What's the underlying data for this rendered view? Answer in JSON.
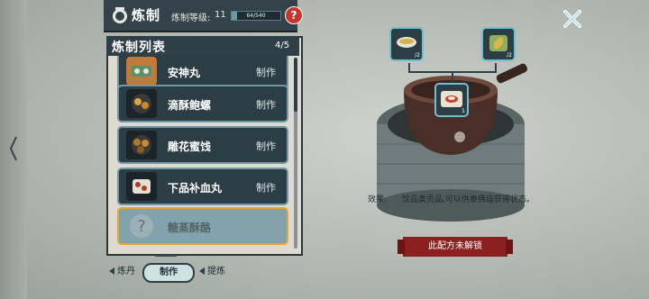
{
  "header": {
    "title": "炼制",
    "level_label": "炼制等级:",
    "level_value": "11",
    "xp_text": "64/540",
    "xp_ratio": 0.12,
    "help_label": "?"
  },
  "panel": {
    "title": "炼制列表",
    "count": "4/5"
  },
  "items": [
    {
      "name": "安神丸",
      "action": "制作",
      "icon": "food-plate-icon",
      "locked": false
    },
    {
      "name": "滴酥鲍螺",
      "action": "制作",
      "icon": "pastry-icon",
      "locked": false
    },
    {
      "name": "雕花蜜饯",
      "action": "制作",
      "icon": "candied-fruit-icon",
      "locked": false
    },
    {
      "name": "下品补血丸",
      "action": "制作",
      "icon": "pills-icon",
      "locked": false
    },
    {
      "name": "糖蒸酥酪",
      "action": "",
      "icon": "question-icon",
      "locked": true
    }
  ],
  "tabs": [
    {
      "label": "炼丹"
    },
    {
      "label": "制作"
    },
    {
      "label": "提炼"
    }
  ],
  "stove": {
    "ingredient1_count": "/2",
    "ingredient2_count": "/2",
    "center_count": "1"
  },
  "effect": {
    "label": "效果:",
    "text": "饮品类贡品,可以供奉佛庙获得状态。"
  },
  "recipe_button": "此配方未解锁",
  "colors": {
    "panel_dark": "#2f3f47",
    "accent_red": "#8c1f1f",
    "locked_border": "#e0a93a"
  }
}
